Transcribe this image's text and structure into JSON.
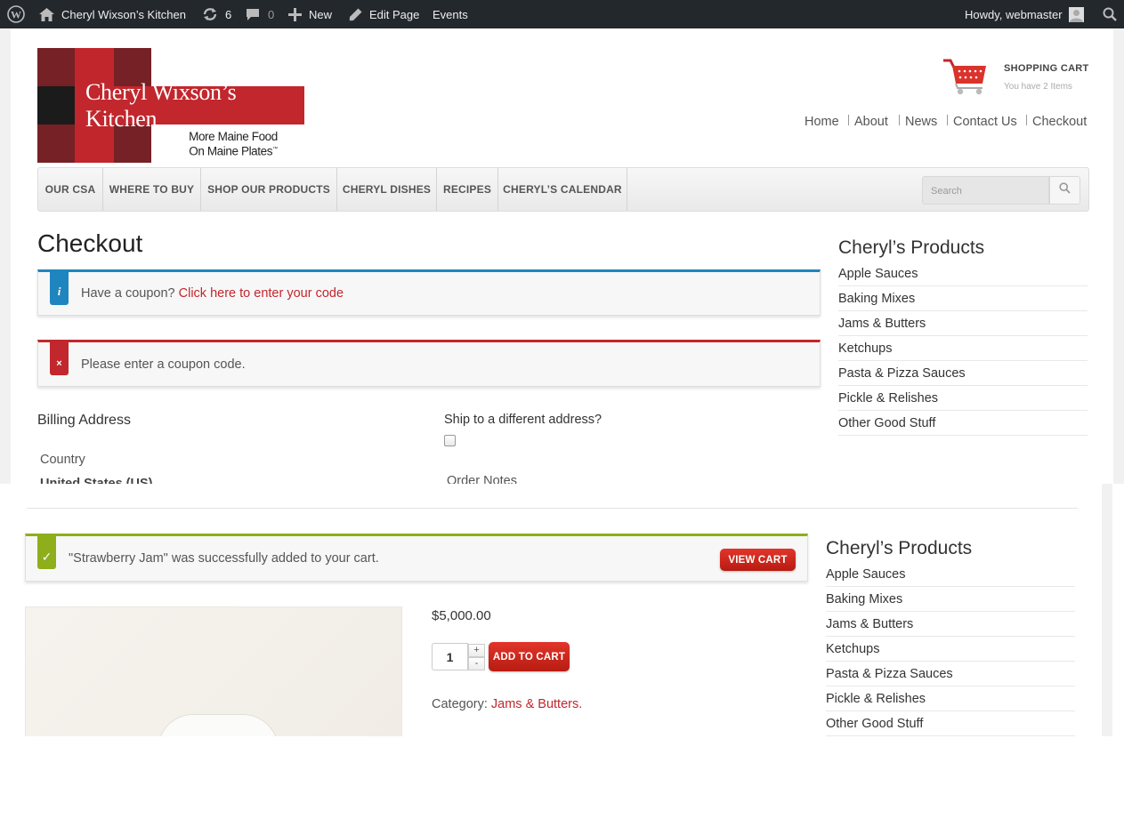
{
  "adminbar": {
    "wp_icon": "wordpress-logo-icon",
    "site_icon": "home-icon",
    "site_name": "Cheryl Wixson’s Kitchen",
    "updates_icon": "refresh-icon",
    "updates_count": "6",
    "comments_icon": "comment-icon",
    "comments_count": "0",
    "new_icon": "plus-icon",
    "new_label": "New",
    "edit_icon": "pencil-icon",
    "edit_label": "Edit Page",
    "events_label": "Events",
    "howdy": "Howdy, webmaster",
    "search_icon": "search-icon"
  },
  "header": {
    "logo_name": "Cheryl Wixson’s Kitchen",
    "logo_tagline_1": "More Maine Food",
    "logo_tagline_2": "On Maine Plates",
    "cart_title": "SHOPPING CART",
    "cart_sub": "You have 2 Items",
    "topnav": [
      "Home",
      "About",
      "News",
      "Contact Us",
      "Checkout"
    ]
  },
  "mainnav": {
    "items": [
      "OUR CSA",
      "WHERE TO BUY",
      "SHOP OUR PRODUCTS",
      "CHERYL DISHES",
      "RECIPES",
      "CHERYL’S CALENDAR"
    ],
    "search_placeholder": "Search"
  },
  "checkout": {
    "title": "Checkout",
    "coupon_prompt": "Have a coupon?",
    "coupon_link": "Click here to enter your code",
    "error": "Please enter a coupon code.",
    "billing_heading": "Billing Address",
    "ship_label": "Ship to a different address?",
    "country_label": "Country",
    "country_value": "United States (US)",
    "order_notes_label": "Order Notes"
  },
  "sidebar": {
    "title": "Cheryl’s Products",
    "items": [
      "Apple Sauces",
      "Baking Mixes",
      "Jams & Butters",
      "Ketchups",
      "Pasta & Pizza Sauces",
      "Pickle & Relishes",
      "Other Good Stuff"
    ]
  },
  "product": {
    "success_msg": "\"Strawberry Jam\" was successfully added to your cart.",
    "view_cart": "VIEW CART",
    "price": "$5,000.00",
    "qty": "1",
    "plus": "+",
    "minus": "-",
    "add_to_cart": "ADD TO CART",
    "category_label": "Category:",
    "category_link": "Jams & Butters",
    "category_end": "."
  },
  "colors": {
    "accent_red": "#c1272d",
    "info_blue": "#1e85be",
    "success_green": "#8fae1b",
    "adminbar_bg": "#23282d"
  }
}
